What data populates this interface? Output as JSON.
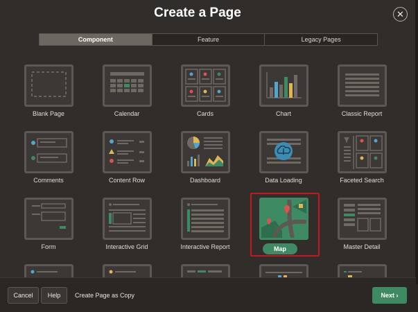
{
  "dialog": {
    "title": "Create a Page",
    "close_icon": "close-icon"
  },
  "tabs": [
    {
      "label": "Component",
      "active": true
    },
    {
      "label": "Feature",
      "active": false
    },
    {
      "label": "Legacy Pages",
      "active": false
    }
  ],
  "tiles": [
    "Blank Page",
    "Calendar",
    "Cards",
    "Chart",
    "Classic Report",
    "Comments",
    "Content Row",
    "Dashboard",
    "Data Loading",
    "Faceted Search",
    "Form",
    "Interactive Grid",
    "Interactive Report",
    "Map",
    "Master Detail"
  ],
  "selected_tile": "Map",
  "footer": {
    "cancel_label": "Cancel",
    "help_label": "Help",
    "copy_label": "Create Page as Copy",
    "next_label": "Next"
  },
  "colors": {
    "accent_green": "#3e8b63",
    "selection_red": "#c4161c",
    "background": "#312d2a"
  }
}
